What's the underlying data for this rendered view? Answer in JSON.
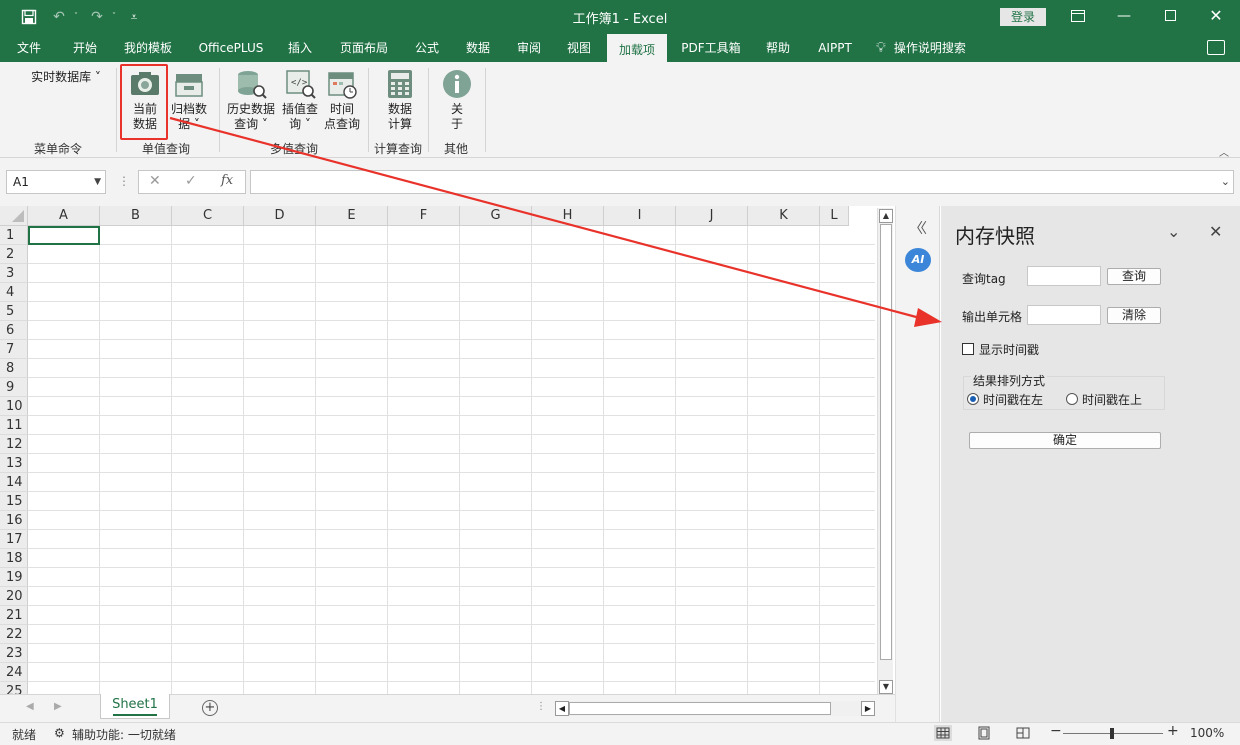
{
  "window": {
    "title": "工作簿1  -  Excel",
    "login": "登录"
  },
  "tabs": [
    {
      "label": "文件"
    },
    {
      "label": "开始"
    },
    {
      "label": "我的模板"
    },
    {
      "label": "OfficePLUS"
    },
    {
      "label": "插入"
    },
    {
      "label": "页面布局"
    },
    {
      "label": "公式"
    },
    {
      "label": "数据"
    },
    {
      "label": "审阅"
    },
    {
      "label": "视图"
    },
    {
      "label": "加载项"
    },
    {
      "label": "PDF工具箱"
    },
    {
      "label": "帮助"
    },
    {
      "label": "AIPPT"
    },
    {
      "label": "操作说明搜索"
    }
  ],
  "ribbon": {
    "realtime_db": "实时数据库 ˅",
    "menu_cmd": "菜单命令",
    "current_data": [
      "当前",
      "数据"
    ],
    "archive_data": [
      "归档数",
      "据 ˅"
    ],
    "history_query": [
      "历史数据",
      "查询 ˅"
    ],
    "interp_query": [
      "插值查",
      "询 ˅"
    ],
    "timepoint_query": [
      "时间",
      "点查询"
    ],
    "data_calc": [
      "数据",
      "计算"
    ],
    "about": [
      "关",
      "于"
    ],
    "groups": {
      "single": "单值查询",
      "multi": "多值查询",
      "calc": "计算查询",
      "other": "其他"
    }
  },
  "formula_bar": {
    "name_box": "A1",
    "fx": "fx"
  },
  "grid": {
    "columns": [
      "A",
      "B",
      "C",
      "D",
      "E",
      "F",
      "G",
      "H",
      "I",
      "J",
      "K",
      "L"
    ],
    "rows": [
      "1",
      "2",
      "3",
      "4",
      "5",
      "6",
      "7",
      "8",
      "9",
      "10",
      "11",
      "12",
      "13",
      "14",
      "15",
      "16",
      "17",
      "18",
      "19",
      "20",
      "21",
      "22",
      "23",
      "24",
      "25"
    ]
  },
  "sheet": {
    "tab": "Sheet1",
    "add": "+"
  },
  "pane": {
    "title": "内存快照",
    "query_tag_label": "查询tag",
    "query_btn": "查询",
    "output_cell_label": "输出单元格",
    "clear_btn": "清除",
    "show_timestamp": "显示时间戳",
    "sort_group": "结果排列方式",
    "ts_left": "时间戳在左",
    "ts_top": "时间戳在上",
    "confirm_btn": "确定"
  },
  "status": {
    "ready": "就绪",
    "accessibility": "辅助功能: 一切就绪",
    "zoom": "100%",
    "zoom_minus": "−",
    "zoom_plus": "+"
  },
  "colors": {
    "excel_green": "#217346",
    "highlight_red": "#e8322a"
  }
}
